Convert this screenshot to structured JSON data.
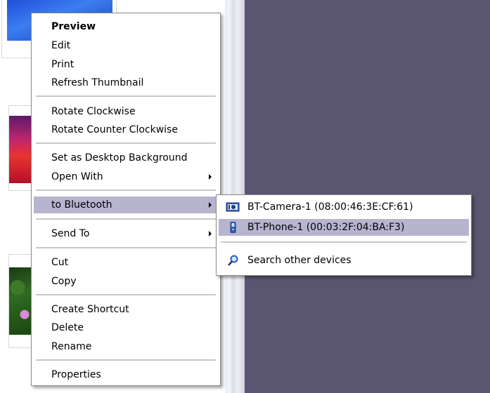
{
  "context_menu": {
    "items": [
      {
        "label": "Preview"
      },
      {
        "label": "Edit"
      },
      {
        "label": "Print"
      },
      {
        "label": "Refresh Thumbnail"
      },
      {
        "label": "Rotate Clockwise"
      },
      {
        "label": "Rotate Counter Clockwise"
      },
      {
        "label": "Set as Desktop Background"
      },
      {
        "label": "Open With"
      },
      {
        "label": "to Bluetooth"
      },
      {
        "label": "Send To"
      },
      {
        "label": "Cut"
      },
      {
        "label": "Copy"
      },
      {
        "label": "Create Shortcut"
      },
      {
        "label": "Delete"
      },
      {
        "label": "Rename"
      },
      {
        "label": "Properties"
      }
    ]
  },
  "bluetooth_submenu": {
    "items": [
      {
        "label": "BT-Camera-1 (08:00:46:3E:CF:61)",
        "icon": "camera-icon"
      },
      {
        "label": "BT-Phone-1 (00:03:2F:04:BA:F3)",
        "icon": "phone-icon"
      },
      {
        "label": "Search other devices",
        "icon": "magnifier-icon"
      }
    ]
  },
  "colors": {
    "highlight": "#b6b4cf",
    "desktop": "#5b5670"
  }
}
